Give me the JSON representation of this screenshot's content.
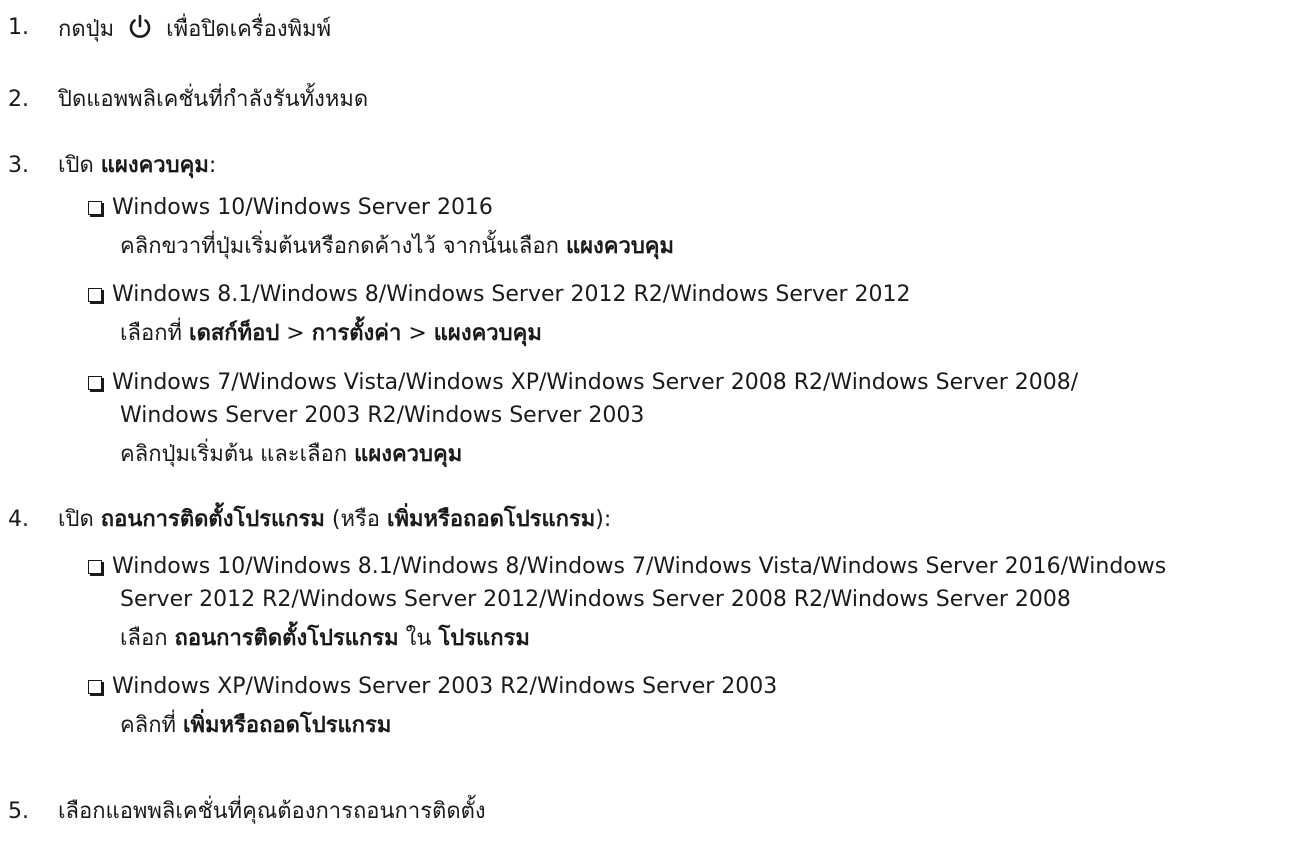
{
  "steps": [
    {
      "num": "1.",
      "pre": "กดปุ่ม",
      "post": "เพื่อปิดเครื่องพิมพ์",
      "icon": "power-icon"
    },
    {
      "num": "2.",
      "text": "ปิดแอพพลิเคชั่นที่กำลังรันทั้งหมด"
    },
    {
      "num": "3.",
      "pre": "เปิด",
      "bold": "แผงควบคุม",
      "post": ":"
    },
    {
      "num": "4.",
      "pre": "เปิด",
      "bold1": "ถอนการติดตั้งโปรแกรม",
      "mid": "(หรือ",
      "bold2": "เพิ่มหรือถอดโปรแกรม",
      "post": "):"
    },
    {
      "num": "5.",
      "text": "เลือกแอพพลิเคชั่นที่คุณต้องการถอนการติดตั้ง"
    }
  ],
  "step3_items": [
    {
      "title": "Windows 10/Windows Server 2016",
      "pre": "คลิกขวาที่ปุ่มเริ่มต้นหรือกดค้างไว้ จากนั้นเลือก",
      "bold": "แผงควบคุม"
    },
    {
      "title": "Windows 8.1/Windows 8/Windows Server 2012 R2/Windows Server 2012",
      "pre": "เลือกที่",
      "b1": "เดสก์ท็อป",
      "sep1": ">",
      "b2": "การตั้งค่า",
      "sep2": ">",
      "b3": "แผงควบคุม"
    },
    {
      "title": "Windows 7/Windows Vista/Windows XP/Windows Server 2008 R2/Windows Server 2008/",
      "title2": "Windows Server 2003 R2/Windows Server 2003",
      "pre": "คลิกปุ่มเริ่มต้น และเลือก",
      "bold": "แผงควบคุม"
    }
  ],
  "step4_items": [
    {
      "title": "Windows 10/Windows 8.1/Windows 8/Windows 7/Windows Vista/Windows Server 2016/Windows",
      "title2": "Server 2012 R2/Windows Server 2012/Windows Server 2008 R2/Windows Server 2008",
      "pre": "เลือก",
      "b1": "ถอนการติดตั้งโปรแกรม",
      "mid": "ใน",
      "b2": "โปรแกรม"
    },
    {
      "title": "Windows XP/Windows Server 2003 R2/Windows Server 2003",
      "pre": "คลิกที่",
      "bold": "เพิ่มหรือถอดโปรแกรม"
    }
  ]
}
